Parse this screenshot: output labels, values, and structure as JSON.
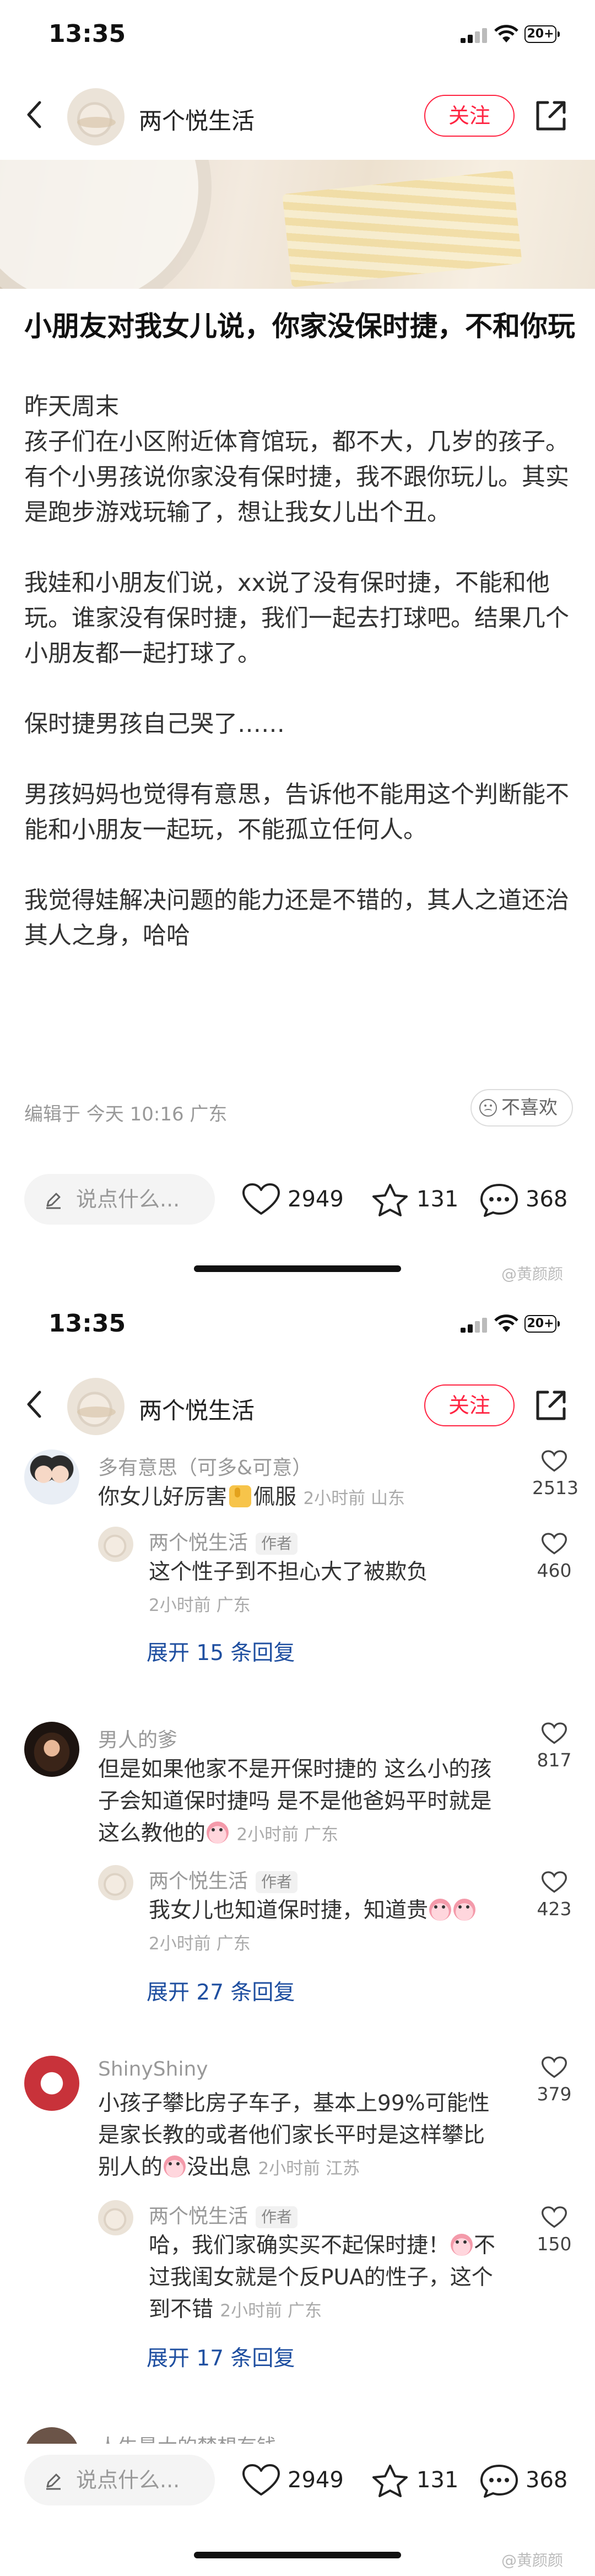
{
  "status": {
    "time": "13:35",
    "battery": "20+"
  },
  "nav": {
    "author": "两个悦生活",
    "follow_label": "关注"
  },
  "post": {
    "title": "小朋友对我女儿说，你家没保时捷，不和你玩",
    "body": "昨天周末\n孩子们在小区附近体育馆玩，都不大，几岁的孩子。\n有个小男孩说你家没有保时捷，我不跟你玩儿。其实是跑步游戏玩输了，想让我女儿出个丑。\n\n我娃和小朋友们说，xx说了没有保时捷，不能和他玩。谁家没有保时捷，我们一起去打球吧。结果几个小朋友都一起打球了。\n\n保时捷男孩自己哭了……\n\n男孩妈妈也觉得有意思，告诉他不能用这个判断能不能和小朋友一起玩，不能孤立任何人。\n\n我觉得娃解决问题的能力还是不错的，其人之道还治其人之身，哈哈",
    "meta": "编辑于 今天 10:16 广东",
    "dislike_label": "不喜欢"
  },
  "bottom_bar": {
    "input_placeholder": "说点什么...",
    "likes": "2949",
    "stars": "131",
    "comments": "368"
  },
  "watermark": "@黄颜颜",
  "comments": [
    {
      "name": "多有意思（可多&可意）",
      "text": "你女儿好厉害",
      "text_after": "佩服",
      "time": "2小时前 山东",
      "likes": "2513",
      "reply": {
        "name": "两个悦生活",
        "tag": "作者",
        "text": "这个性子到不担心大了被欺负",
        "time": "2小时前 广东",
        "likes": "460"
      },
      "expand": "展开 15 条回复"
    },
    {
      "name": "男人的爹",
      "text": "但是如果他家不是开保时捷的 这么小的孩子会知道保时捷吗 是不是他爸妈平时就是这么教他的",
      "time": "2小时前 广东",
      "likes": "817",
      "reply": {
        "name": "两个悦生活",
        "tag": "作者",
        "text": "我女儿也知道保时捷，知道贵",
        "time": "2小时前 广东",
        "likes": "423"
      },
      "expand": "展开 27 条回复"
    },
    {
      "name": "ShinyShiny",
      "text": "小孩子攀比房子车子，基本上99%可能性是家长教的或者他们家长平时是这样攀比别人的",
      "text_after": "没出息",
      "time": "2小时前 江苏",
      "likes": "379",
      "reply": {
        "name": "两个悦生活",
        "tag": "作者",
        "text": "哈，我们家确实买不起保时捷！",
        "text_after": "不过我闺女就是个反PUA的性子，这个到不错",
        "time": "2小时前 广东",
        "likes": "150"
      },
      "expand": "展开 17 条回复"
    },
    {
      "name": "人生最大的梦想有钱"
    }
  ]
}
